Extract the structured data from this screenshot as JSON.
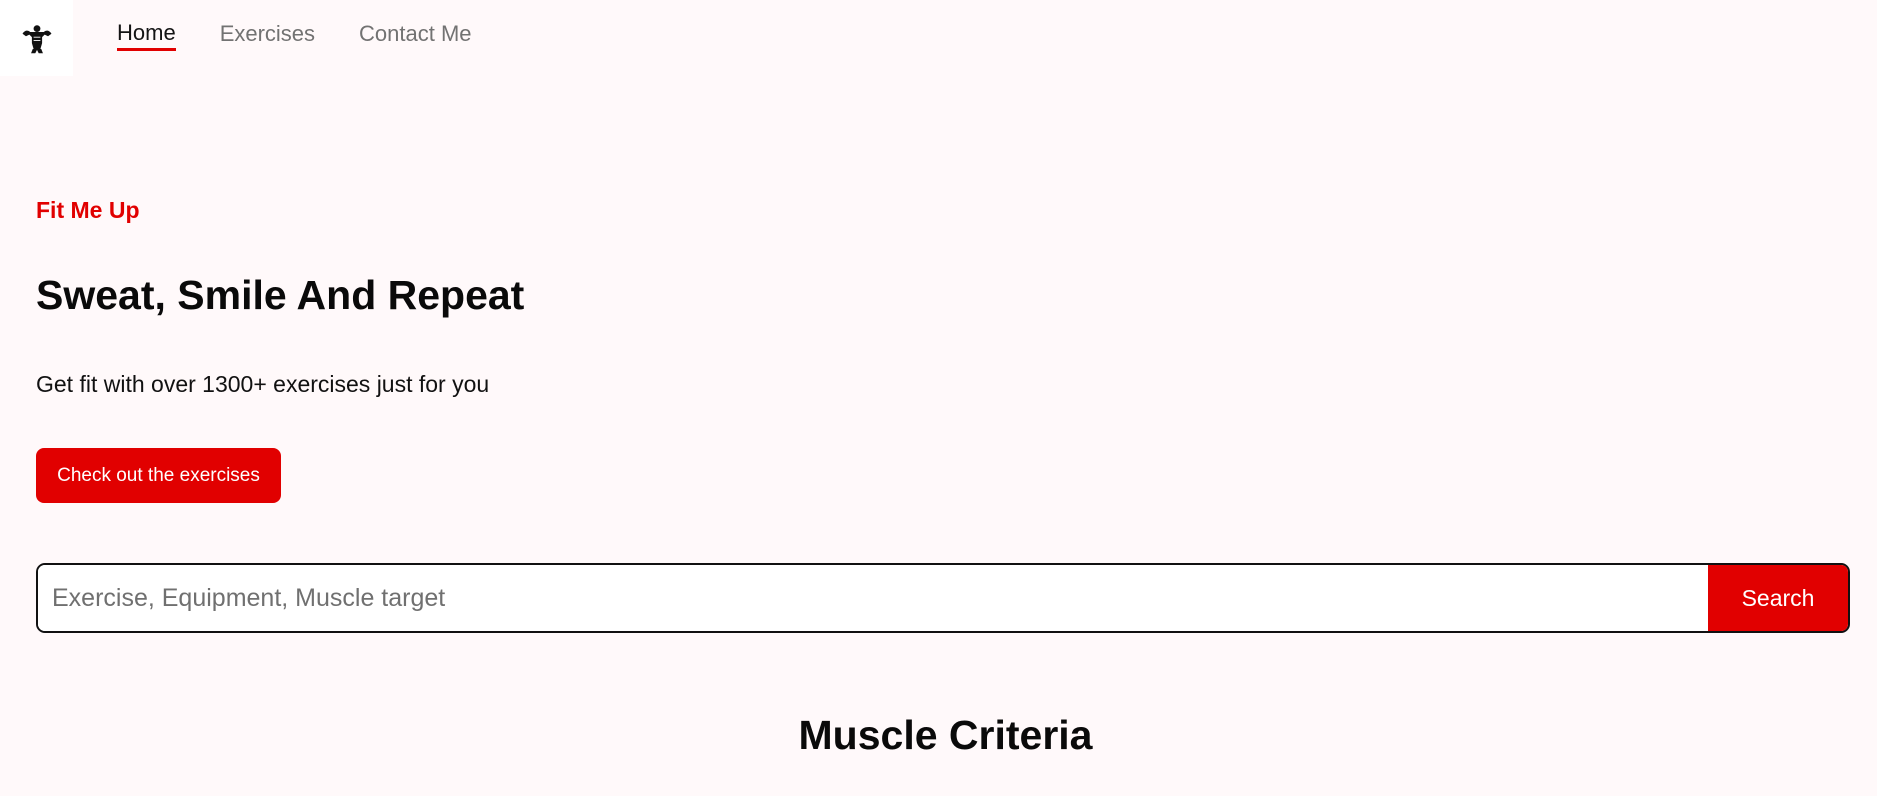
{
  "nav": {
    "logo_icon": "muscle-man-icon",
    "links": [
      {
        "label": "Home",
        "active": true
      },
      {
        "label": "Exercises",
        "active": false
      },
      {
        "label": "Contact Me",
        "active": false
      }
    ]
  },
  "hero": {
    "eyebrow": "Fit Me Up",
    "headline": "Sweat, Smile And Repeat",
    "subtext": "Get fit with over 1300+ exercises just for you",
    "cta_label": "Check out the exercises"
  },
  "search": {
    "placeholder": "Exercise, Equipment, Muscle target",
    "value": "",
    "button_label": "Search"
  },
  "section": {
    "title": "Muscle Criteria"
  },
  "colors": {
    "accent": "#e10000",
    "background": "#fff9fa"
  }
}
